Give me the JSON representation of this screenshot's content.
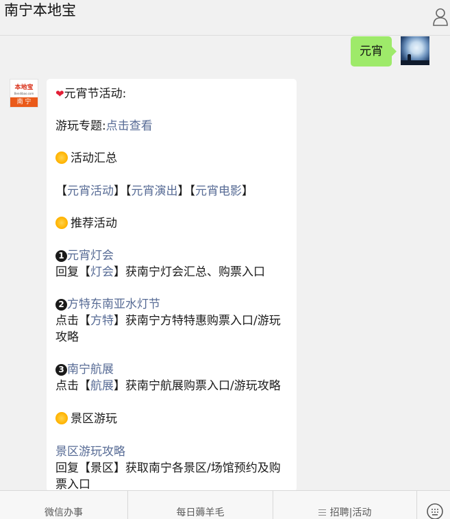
{
  "header": {
    "title": "南宁本地宝",
    "profile_icon": "user-profile-icon"
  },
  "messages": {
    "user_text": "元宵",
    "bot": {
      "avatar_logo": "本地宝",
      "avatar_site": "Bendibao.com",
      "avatar_city": "南 宁",
      "heart_icon": "❤",
      "title": "元宵节活动:",
      "special_prefix": "游玩专题:",
      "special_link": "点击查看",
      "section1": "活动汇总",
      "bracket_open": "【",
      "bracket_close": "】",
      "link_activity": "元宵活动",
      "link_show": "元宵演出",
      "link_movie": "元宵电影",
      "section2": "推荐活动",
      "num1": "1",
      "item1_title": "元宵灯会",
      "item1_pre": "回复【",
      "item1_kw": "灯会",
      "item1_post": "】获南宁灯会汇总、购票入口",
      "num2": "2",
      "item2_title": "方特东南亚水灯节",
      "item2_pre": "点击【",
      "item2_kw": "方特",
      "item2_post": "】获南宁方特特惠购票入口/游玩攻略",
      "num3": "3",
      "item3_title": "南宁航展",
      "item3_pre": "点击【",
      "item3_kw": "航展",
      "item3_post": "】获南宁航展购票入口/游玩攻略",
      "section3": "景区游玩",
      "scenic_link": "景区游玩攻略",
      "scenic_text": "回复【景区】获取南宁各景区/场馆预约及购票入口"
    }
  },
  "bottom_menu": {
    "item1": "微信办事",
    "item2": "每日薅羊毛",
    "item3": "招聘|活动",
    "keyboard_icon": "keyboard-icon",
    "menu_icon": "menu-lines-icon"
  },
  "colors": {
    "user_bubble": "#9eea6a",
    "link": "#576b95",
    "background": "#f1f1f1"
  }
}
